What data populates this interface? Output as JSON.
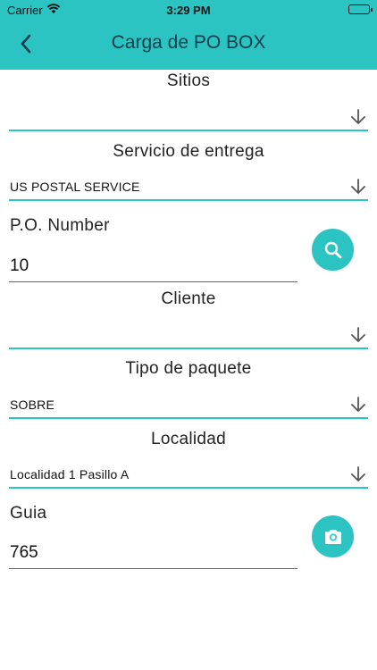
{
  "status_bar": {
    "carrier": "Carrier",
    "time": "3:29 PM"
  },
  "header": {
    "title": "Carga de PO BOX",
    "back_icon": "chevron-left-icon"
  },
  "form": {
    "sitios": {
      "label": "Sitios",
      "value": ""
    },
    "servicio": {
      "label": "Servicio de entrega",
      "value": "US POSTAL SERVICE"
    },
    "po_number": {
      "label": "P.O. Number",
      "value": "10",
      "button_icon": "search-icon"
    },
    "cliente": {
      "label": "Cliente",
      "value": ""
    },
    "tipo_paquete": {
      "label": "Tipo de paquete",
      "value": "SOBRE"
    },
    "localidad": {
      "label": "Localidad",
      "value": "Localidad 1 Pasillo A"
    },
    "guia": {
      "label": "Guia",
      "value": "765",
      "button_icon": "camera-icon"
    }
  },
  "colors": {
    "accent": "#2cc3c3",
    "title_text": "#0f3d4a",
    "icon_white": "#ffffff"
  }
}
